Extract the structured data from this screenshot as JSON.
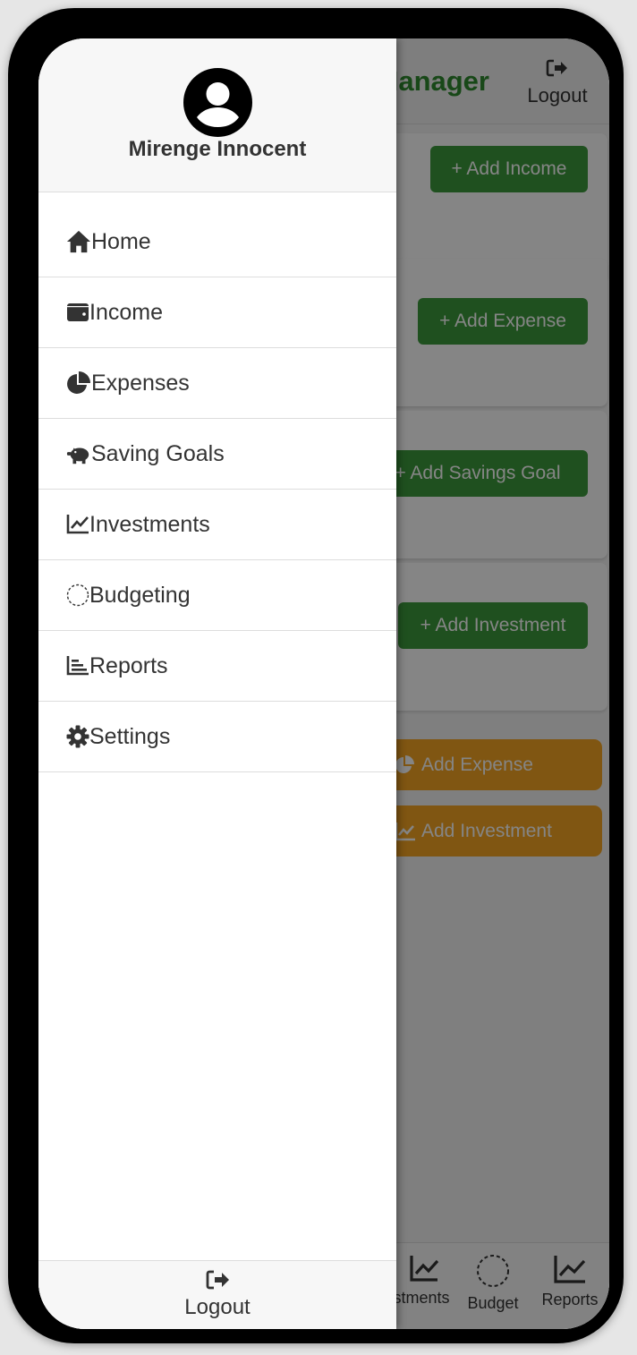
{
  "app": {
    "title": "Finance Manager",
    "header_logout": "Logout"
  },
  "cards": [
    {
      "button": "+ Add Income"
    },
    {
      "button": "+ Add Expense"
    },
    {
      "button": "+ Add Savings Goal"
    },
    {
      "button": "+ Add Investment"
    }
  ],
  "quick_actions": [
    {
      "label": "Add Expense",
      "icon": "pie-chart-icon"
    },
    {
      "label": "Add Investment",
      "icon": "chart-line-icon"
    }
  ],
  "bottom_nav": [
    {
      "label": "Investments",
      "icon": "chart-line-icon"
    },
    {
      "label": "Budget",
      "icon": "dashed-circle-icon"
    },
    {
      "label": "Reports",
      "icon": "chart-line-icon"
    }
  ],
  "drawer": {
    "user_name": "Mirenge Innocent",
    "items": [
      {
        "label": "Home",
        "icon": "home-icon"
      },
      {
        "label": "Income",
        "icon": "wallet-icon"
      },
      {
        "label": "Expenses",
        "icon": "pie-chart-icon"
      },
      {
        "label": "Saving Goals",
        "icon": "piggy-bank-icon"
      },
      {
        "label": "Investments",
        "icon": "chart-line-icon"
      },
      {
        "label": "Budgeting",
        "icon": "dashed-circle-icon"
      },
      {
        "label": "Reports",
        "icon": "bar-chart-icon"
      },
      {
        "label": "Settings",
        "icon": "gear-icon"
      }
    ],
    "logout": "Logout"
  },
  "colors": {
    "green": "#3d9a3d",
    "orange": "#f5a623",
    "title_green": "#2f8a2f",
    "text": "#333333"
  }
}
